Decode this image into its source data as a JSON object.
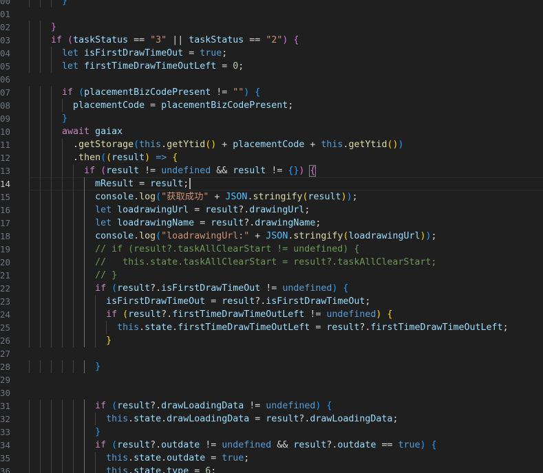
{
  "editor": {
    "active_line": "14",
    "lines": [
      {
        "n": "00",
        "indent": 3,
        "tokens": [
          [
            "}",
            "b3"
          ]
        ]
      },
      {
        "n": "01",
        "indent": 0,
        "tokens": []
      },
      {
        "n": "02",
        "indent": 2,
        "tokens": [
          [
            "}",
            "b2"
          ]
        ]
      },
      {
        "n": "03",
        "indent": 2,
        "tokens": [
          [
            "if",
            "kw"
          ],
          [
            " ",
            "p"
          ],
          [
            "(",
            "b2"
          ],
          [
            "taskStatus",
            "var"
          ],
          [
            " == ",
            "p"
          ],
          [
            "\"3\"",
            "str"
          ],
          [
            " || ",
            "p"
          ],
          [
            "taskStatus",
            "var"
          ],
          [
            " == ",
            "p"
          ],
          [
            "\"2\"",
            "str"
          ],
          [
            ")",
            "b2"
          ],
          [
            " ",
            "p"
          ],
          [
            "{",
            "b2"
          ]
        ]
      },
      {
        "n": "04",
        "indent": 3,
        "tokens": [
          [
            "let",
            "st"
          ],
          [
            " ",
            "p"
          ],
          [
            "isFirstDrawTimeOut",
            "var"
          ],
          [
            " = ",
            "p"
          ],
          [
            "true",
            "st"
          ],
          [
            ";",
            "p"
          ]
        ]
      },
      {
        "n": "05",
        "indent": 3,
        "tokens": [
          [
            "let",
            "st"
          ],
          [
            " ",
            "p"
          ],
          [
            "firstTimeDrawTimeOutLeft",
            "var"
          ],
          [
            " = ",
            "p"
          ],
          [
            "0",
            "num"
          ],
          [
            ";",
            "p"
          ]
        ]
      },
      {
        "n": "06",
        "indent": 0,
        "tokens": []
      },
      {
        "n": "07",
        "indent": 3,
        "tokens": [
          [
            "if",
            "kw"
          ],
          [
            " ",
            "p"
          ],
          [
            "(",
            "b3"
          ],
          [
            "placementBizCodePresent",
            "var"
          ],
          [
            " != ",
            "p"
          ],
          [
            "\"\"",
            "str"
          ],
          [
            ")",
            "b3"
          ],
          [
            " ",
            "p"
          ],
          [
            "{",
            "b3"
          ]
        ]
      },
      {
        "n": "08",
        "indent": 4,
        "tokens": [
          [
            "placementCode",
            "var"
          ],
          [
            " = ",
            "p"
          ],
          [
            "placementBizCodePresent",
            "var"
          ],
          [
            ";",
            "p"
          ]
        ]
      },
      {
        "n": "09",
        "indent": 3,
        "tokens": [
          [
            "}",
            "b3"
          ]
        ]
      },
      {
        "n": "10",
        "indent": 3,
        "tokens": [
          [
            "await",
            "kw"
          ],
          [
            " ",
            "p"
          ],
          [
            "gaiax",
            "var"
          ]
        ]
      },
      {
        "n": "11",
        "indent": 4,
        "tokens": [
          [
            ".",
            "p"
          ],
          [
            "getStorage",
            "fn"
          ],
          [
            "(",
            "b3"
          ],
          [
            "this",
            "st"
          ],
          [
            ".",
            "p"
          ],
          [
            "getYtid",
            "fn"
          ],
          [
            "()",
            "b1"
          ],
          [
            " + ",
            "p"
          ],
          [
            "placementCode",
            "var"
          ],
          [
            " + ",
            "p"
          ],
          [
            "this",
            "st"
          ],
          [
            ".",
            "p"
          ],
          [
            "getYtid",
            "fn"
          ],
          [
            "()",
            "b1"
          ],
          [
            ")",
            "b3"
          ]
        ]
      },
      {
        "n": "12",
        "indent": 4,
        "tokens": [
          [
            ".",
            "p"
          ],
          [
            "then",
            "fn"
          ],
          [
            "(",
            "b3"
          ],
          [
            "(",
            "b1"
          ],
          [
            "result",
            "var"
          ],
          [
            ")",
            "b1"
          ],
          [
            " ",
            "p"
          ],
          [
            "=>",
            "st"
          ],
          [
            " ",
            "p"
          ],
          [
            "{",
            "b1"
          ]
        ]
      },
      {
        "n": "13",
        "indent": 5,
        "tokens": [
          [
            "if",
            "kw"
          ],
          [
            " ",
            "p"
          ],
          [
            "(",
            "b2"
          ],
          [
            "result",
            "var"
          ],
          [
            " != ",
            "p"
          ],
          [
            "undefined",
            "st"
          ],
          [
            " && ",
            "p"
          ],
          [
            "result",
            "var"
          ],
          [
            " != ",
            "p"
          ],
          [
            "{}",
            "b3"
          ],
          [
            ")",
            "b2"
          ],
          [
            " ",
            "p"
          ],
          [
            "{",
            "b2bh"
          ]
        ]
      },
      {
        "n": "14",
        "indent": 6,
        "tokens": [
          [
            "mResult",
            "var"
          ],
          [
            " = ",
            "p"
          ],
          [
            "result",
            "var"
          ],
          [
            ";",
            "p"
          ]
        ],
        "cursor": true
      },
      {
        "n": "15",
        "indent": 6,
        "tokens": [
          [
            "console",
            "var"
          ],
          [
            ".",
            "p"
          ],
          [
            "log",
            "fn"
          ],
          [
            "(",
            "b3"
          ],
          [
            "\"获取成功\"",
            "str"
          ],
          [
            " + ",
            "p"
          ],
          [
            "JSON",
            "obj"
          ],
          [
            ".",
            "p"
          ],
          [
            "stringify",
            "fn"
          ],
          [
            "(",
            "b1"
          ],
          [
            "result",
            "var"
          ],
          [
            ")",
            "b1"
          ],
          [
            ")",
            "b3"
          ],
          [
            ";",
            "p"
          ]
        ]
      },
      {
        "n": "16",
        "indent": 6,
        "tokens": [
          [
            "let",
            "st"
          ],
          [
            " ",
            "p"
          ],
          [
            "loadrawingUrl",
            "var"
          ],
          [
            " = ",
            "p"
          ],
          [
            "result",
            "var"
          ],
          [
            "?.",
            "p"
          ],
          [
            "drawingUrl",
            "var"
          ],
          [
            ";",
            "p"
          ]
        ]
      },
      {
        "n": "17",
        "indent": 6,
        "tokens": [
          [
            "let",
            "st"
          ],
          [
            " ",
            "p"
          ],
          [
            "loadrawingName",
            "var"
          ],
          [
            " = ",
            "p"
          ],
          [
            "result",
            "var"
          ],
          [
            "?.",
            "p"
          ],
          [
            "drawingName",
            "var"
          ],
          [
            ";",
            "p"
          ]
        ]
      },
      {
        "n": "18",
        "indent": 6,
        "tokens": [
          [
            "console",
            "var"
          ],
          [
            ".",
            "p"
          ],
          [
            "log",
            "fn"
          ],
          [
            "(",
            "b3"
          ],
          [
            "\"loadrawingUrl:\"",
            "str"
          ],
          [
            " + ",
            "p"
          ],
          [
            "JSON",
            "obj"
          ],
          [
            ".",
            "p"
          ],
          [
            "stringify",
            "fn"
          ],
          [
            "(",
            "b1"
          ],
          [
            "loadrawingUrl",
            "var"
          ],
          [
            ")",
            "b1"
          ],
          [
            ")",
            "b3"
          ],
          [
            ";",
            "p"
          ]
        ]
      },
      {
        "n": "19",
        "indent": 6,
        "tokens": [
          [
            "// if (result?.taskAllClearStart != undefined) {",
            "cm"
          ]
        ]
      },
      {
        "n": "20",
        "indent": 6,
        "tokens": [
          [
            "//   this.state.taskAllClearStart = result?.taskAllClearStart;",
            "cm"
          ]
        ]
      },
      {
        "n": "21",
        "indent": 6,
        "tokens": [
          [
            "// }",
            "cm"
          ]
        ]
      },
      {
        "n": "22",
        "indent": 6,
        "tokens": [
          [
            "if",
            "kw"
          ],
          [
            " ",
            "p"
          ],
          [
            "(",
            "b3"
          ],
          [
            "result",
            "var"
          ],
          [
            "?.",
            "p"
          ],
          [
            "isFirstDrawTimeOut",
            "var"
          ],
          [
            " != ",
            "p"
          ],
          [
            "undefined",
            "st"
          ],
          [
            ")",
            "b3"
          ],
          [
            " ",
            "p"
          ],
          [
            "{",
            "b3"
          ]
        ]
      },
      {
        "n": "23",
        "indent": 7,
        "tokens": [
          [
            "isFirstDrawTimeOut",
            "var"
          ],
          [
            " = ",
            "p"
          ],
          [
            "result",
            "var"
          ],
          [
            "?.",
            "p"
          ],
          [
            "isFirstDrawTimeOut",
            "var"
          ],
          [
            ";",
            "p"
          ]
        ]
      },
      {
        "n": "24",
        "indent": 7,
        "tokens": [
          [
            "if",
            "kw"
          ],
          [
            " ",
            "p"
          ],
          [
            "(",
            "b1"
          ],
          [
            "result",
            "var"
          ],
          [
            "?.",
            "p"
          ],
          [
            "firstTimeDrawTimeOutLeft",
            "var"
          ],
          [
            " != ",
            "p"
          ],
          [
            "undefined",
            "st"
          ],
          [
            ")",
            "b1"
          ],
          [
            " ",
            "p"
          ],
          [
            "{",
            "b1"
          ]
        ]
      },
      {
        "n": "25",
        "indent": 8,
        "tokens": [
          [
            "this",
            "st"
          ],
          [
            ".",
            "p"
          ],
          [
            "state",
            "var"
          ],
          [
            ".",
            "p"
          ],
          [
            "firstTimeDrawTimeOutLeft",
            "var"
          ],
          [
            " = ",
            "p"
          ],
          [
            "result",
            "var"
          ],
          [
            "?.",
            "p"
          ],
          [
            "firstTimeDrawTimeOutLeft",
            "var"
          ],
          [
            ";",
            "p"
          ]
        ]
      },
      {
        "n": "26",
        "indent": 7,
        "tokens": [
          [
            "}",
            "b1"
          ]
        ]
      },
      {
        "n": "27",
        "indent": 0,
        "tokens": []
      },
      {
        "n": "28",
        "indent": 6,
        "tokens": [
          [
            "}",
            "b3"
          ]
        ]
      },
      {
        "n": "29",
        "indent": 0,
        "tokens": []
      },
      {
        "n": "30",
        "indent": 0,
        "tokens": []
      },
      {
        "n": "31",
        "indent": 6,
        "tokens": [
          [
            "if",
            "kw"
          ],
          [
            " ",
            "p"
          ],
          [
            "(",
            "b3"
          ],
          [
            "result",
            "var"
          ],
          [
            "?.",
            "p"
          ],
          [
            "drawLoadingData",
            "var"
          ],
          [
            " != ",
            "p"
          ],
          [
            "undefined",
            "st"
          ],
          [
            ")",
            "b3"
          ],
          [
            " ",
            "p"
          ],
          [
            "{",
            "b3"
          ]
        ]
      },
      {
        "n": "32",
        "indent": 7,
        "tokens": [
          [
            "this",
            "st"
          ],
          [
            ".",
            "p"
          ],
          [
            "state",
            "var"
          ],
          [
            ".",
            "p"
          ],
          [
            "drawLoadingData",
            "var"
          ],
          [
            " = ",
            "p"
          ],
          [
            "result",
            "var"
          ],
          [
            "?.",
            "p"
          ],
          [
            "drawLoadingData",
            "var"
          ],
          [
            ";",
            "p"
          ]
        ]
      },
      {
        "n": "33",
        "indent": 6,
        "tokens": [
          [
            "}",
            "b3"
          ]
        ]
      },
      {
        "n": "34",
        "indent": 6,
        "tokens": [
          [
            "if",
            "kw"
          ],
          [
            " ",
            "p"
          ],
          [
            "(",
            "b3"
          ],
          [
            "result",
            "var"
          ],
          [
            "?.",
            "p"
          ],
          [
            "outdate",
            "var"
          ],
          [
            " != ",
            "p"
          ],
          [
            "undefined",
            "st"
          ],
          [
            " && ",
            "p"
          ],
          [
            "result",
            "var"
          ],
          [
            "?.",
            "p"
          ],
          [
            "outdate",
            "var"
          ],
          [
            " == ",
            "p"
          ],
          [
            "true",
            "st"
          ],
          [
            ")",
            "b3"
          ],
          [
            " ",
            "p"
          ],
          [
            "{",
            "b3"
          ]
        ]
      },
      {
        "n": "35",
        "indent": 7,
        "tokens": [
          [
            "this",
            "st"
          ],
          [
            ".",
            "p"
          ],
          [
            "state",
            "var"
          ],
          [
            ".",
            "p"
          ],
          [
            "outdate",
            "var"
          ],
          [
            " = ",
            "p"
          ],
          [
            "true",
            "st"
          ],
          [
            ";",
            "p"
          ]
        ]
      },
      {
        "n": "36",
        "indent": 7,
        "tokens": [
          [
            "this",
            "st"
          ],
          [
            ".",
            "p"
          ],
          [
            "state",
            "var"
          ],
          [
            ".",
            "p"
          ],
          [
            "type",
            "var"
          ],
          [
            " = ",
            "p"
          ],
          [
            "6",
            "num"
          ],
          [
            ";",
            "p"
          ]
        ]
      }
    ]
  },
  "colors": {
    "background": "#1f1f1f",
    "keyword": "#c586c0",
    "storage": "#569cd6",
    "variable": "#9cdcfe",
    "function": "#dcdcaa",
    "string": "#ce9178",
    "number": "#b5cea8",
    "comment": "#6a9955"
  }
}
